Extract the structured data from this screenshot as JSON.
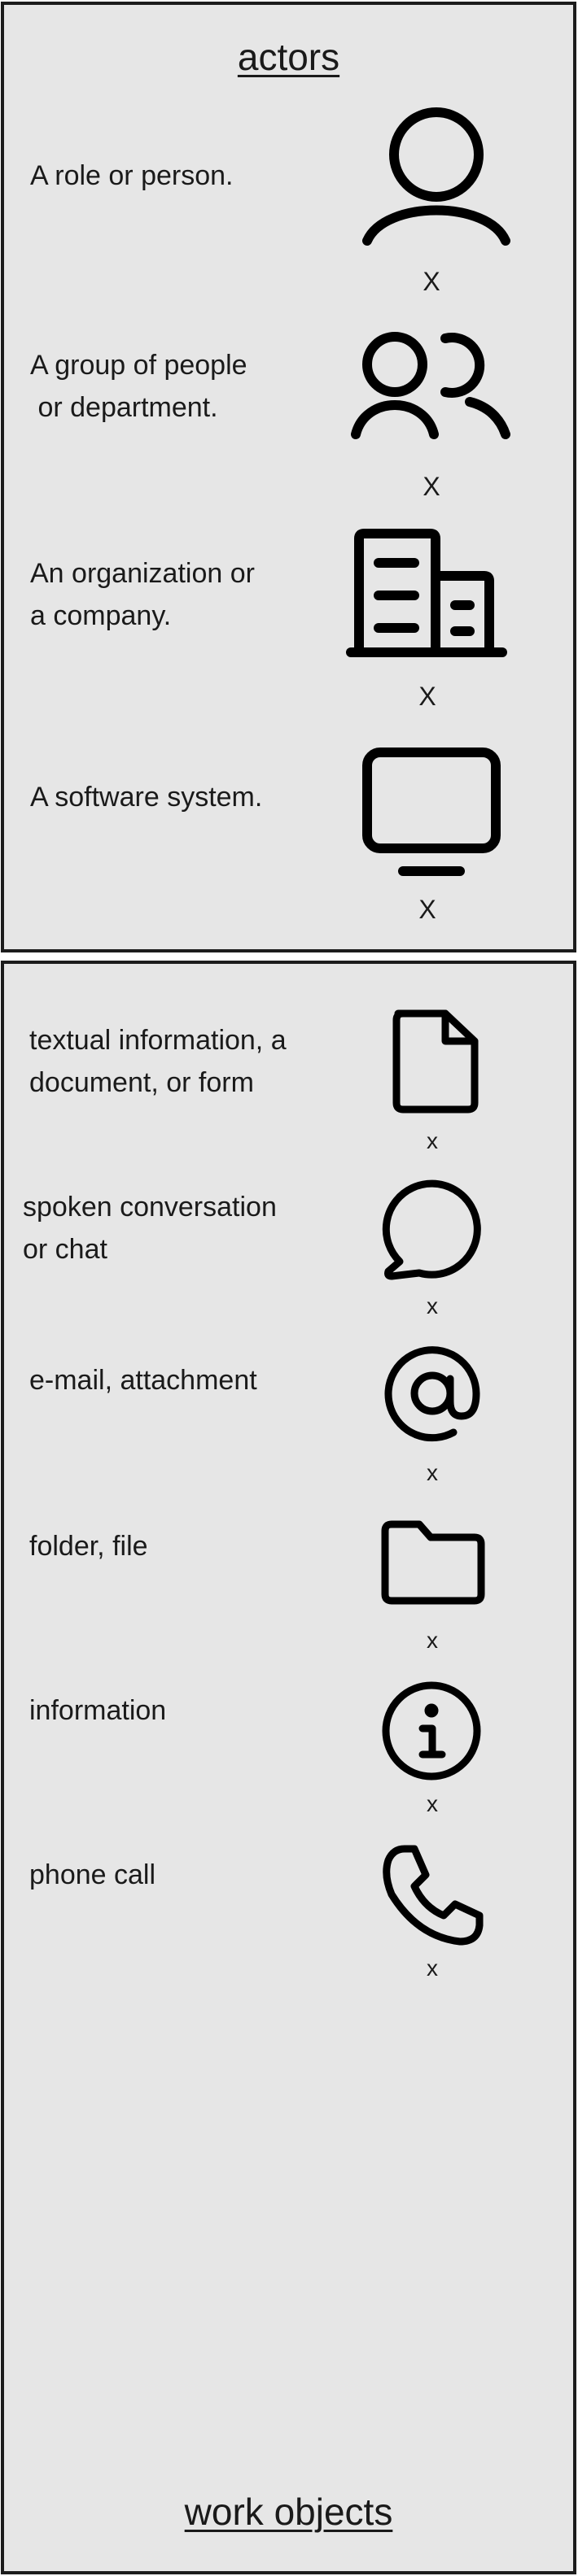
{
  "actors": {
    "title": "actors",
    "items": [
      {
        "label": "A role or person.",
        "icon": "person-icon",
        "mark": "X"
      },
      {
        "label": "A group of people\n or department.",
        "icon": "group-icon",
        "mark": "X"
      },
      {
        "label": "An organization or\na company.",
        "icon": "building-icon",
        "mark": "X"
      },
      {
        "label": "A software system.",
        "icon": "monitor-icon",
        "mark": "X"
      }
    ]
  },
  "work_objects": {
    "title": "work objects",
    "items": [
      {
        "label": "textual information, a\ndocument, or form",
        "icon": "document-icon",
        "mark": "x"
      },
      {
        "label": "spoken conversation\nor chat",
        "icon": "chat-bubble-icon",
        "mark": "x"
      },
      {
        "label": "e-mail, attachment",
        "icon": "at-sign-icon",
        "mark": "x"
      },
      {
        "label": "folder, file",
        "icon": "folder-icon",
        "mark": "x"
      },
      {
        "label": "information",
        "icon": "info-icon",
        "mark": "x"
      },
      {
        "label": "phone call",
        "icon": "phone-icon",
        "mark": "x"
      }
    ]
  },
  "colors": {
    "panel_background": "#e6e6e6",
    "border": "#1c1c1c",
    "icon_stroke": "#000000"
  }
}
